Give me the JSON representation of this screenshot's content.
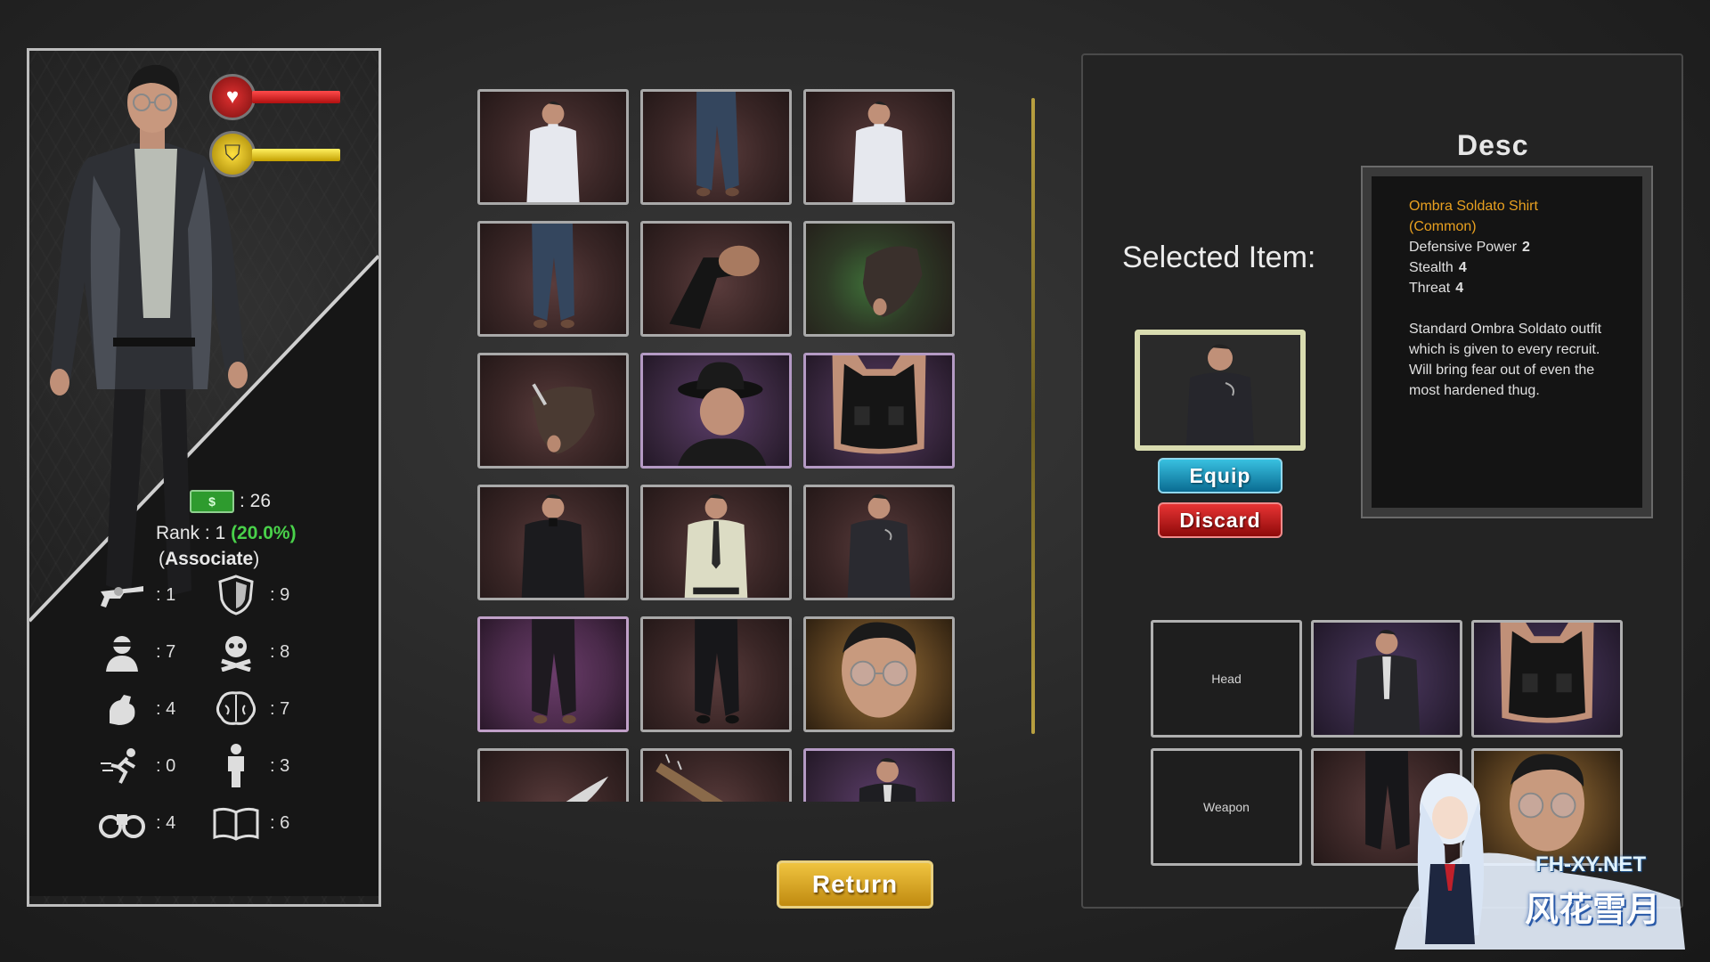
{
  "colors": {
    "health_bar": "#d62828",
    "armor_bar": "#e8c400",
    "rank_pct": "#49d14a",
    "desc_name": "#e8a020",
    "equip": "#1a9cc4",
    "discard": "#c41a1a",
    "return": "#e0a820"
  },
  "character": {
    "health_icon": "heart-pulse-icon",
    "armor_icon": "shield-badge-icon",
    "health_level": 0.9,
    "armor_level": 0.9,
    "money_icon": "dollar-bill-icon",
    "money_label": "$",
    "money_value": ": 26",
    "rank_prefix": "Rank : 1",
    "rank_pct": "(20.0%)",
    "title_open": "(",
    "title": "Associate",
    "title_close": ")",
    "stats": [
      {
        "icon": "revolver-icon",
        "value": ": 1"
      },
      {
        "icon": "shield-icon",
        "value": ": 9"
      },
      {
        "icon": "thug-masked-icon",
        "value": ": 7"
      },
      {
        "icon": "skull-crossbones-icon",
        "value": ": 8"
      },
      {
        "icon": "flexed-arm-icon",
        "value": ": 4"
      },
      {
        "icon": "brain-icon",
        "value": ": 7"
      },
      {
        "icon": "running-man-icon",
        "value": ": 0"
      },
      {
        "icon": "standing-man-icon",
        "value": ": 3"
      },
      {
        "icon": "binoculars-icon",
        "value": ": 4"
      },
      {
        "icon": "open-book-icon",
        "value": ": 6"
      }
    ]
  },
  "inventory": [
    "white-turtleneck",
    "blue-jeans",
    "white-turtleneck",
    "blue-jeans",
    "pistol",
    "leather-glove",
    "knuckle-glove",
    "black-fedora",
    "tactical-vest",
    "black-suit",
    "cream-shirt-tie",
    "ombra-soldato-shirt",
    "black-trousers",
    "black-trousers",
    "glasses-face",
    "knife",
    "spiked-bat",
    "jacket"
  ],
  "selected": {
    "label": "Selected Item:",
    "thumb_icon": "ombra-soldato-shirt",
    "equip_label": "Equip",
    "discard_label": "Discard"
  },
  "desc": {
    "title": "Desc",
    "name": "Ombra Soldato Shirt",
    "rarity": "(Common)",
    "stats": [
      {
        "label": "Defensive Power",
        "value": "2"
      },
      {
        "label": "Stealth",
        "value": "4"
      },
      {
        "label": "Threat",
        "value": "4"
      }
    ],
    "body": "Standard Ombra Soldato outfit which is given to every recruit. Will bring fear out of even the most hardened thug."
  },
  "equipment": [
    {
      "slot": "Head",
      "item": null
    },
    {
      "slot": null,
      "item": "leather-jacket"
    },
    {
      "slot": null,
      "item": "tactical-vest"
    },
    {
      "slot": "Weapon",
      "item": null
    },
    {
      "slot": null,
      "item": "black-trousers"
    },
    {
      "slot": null,
      "item": "glasses-face"
    }
  ],
  "return_label": "Return",
  "watermark": {
    "url": "FH-XY.NET",
    "text": "风花雪月"
  }
}
